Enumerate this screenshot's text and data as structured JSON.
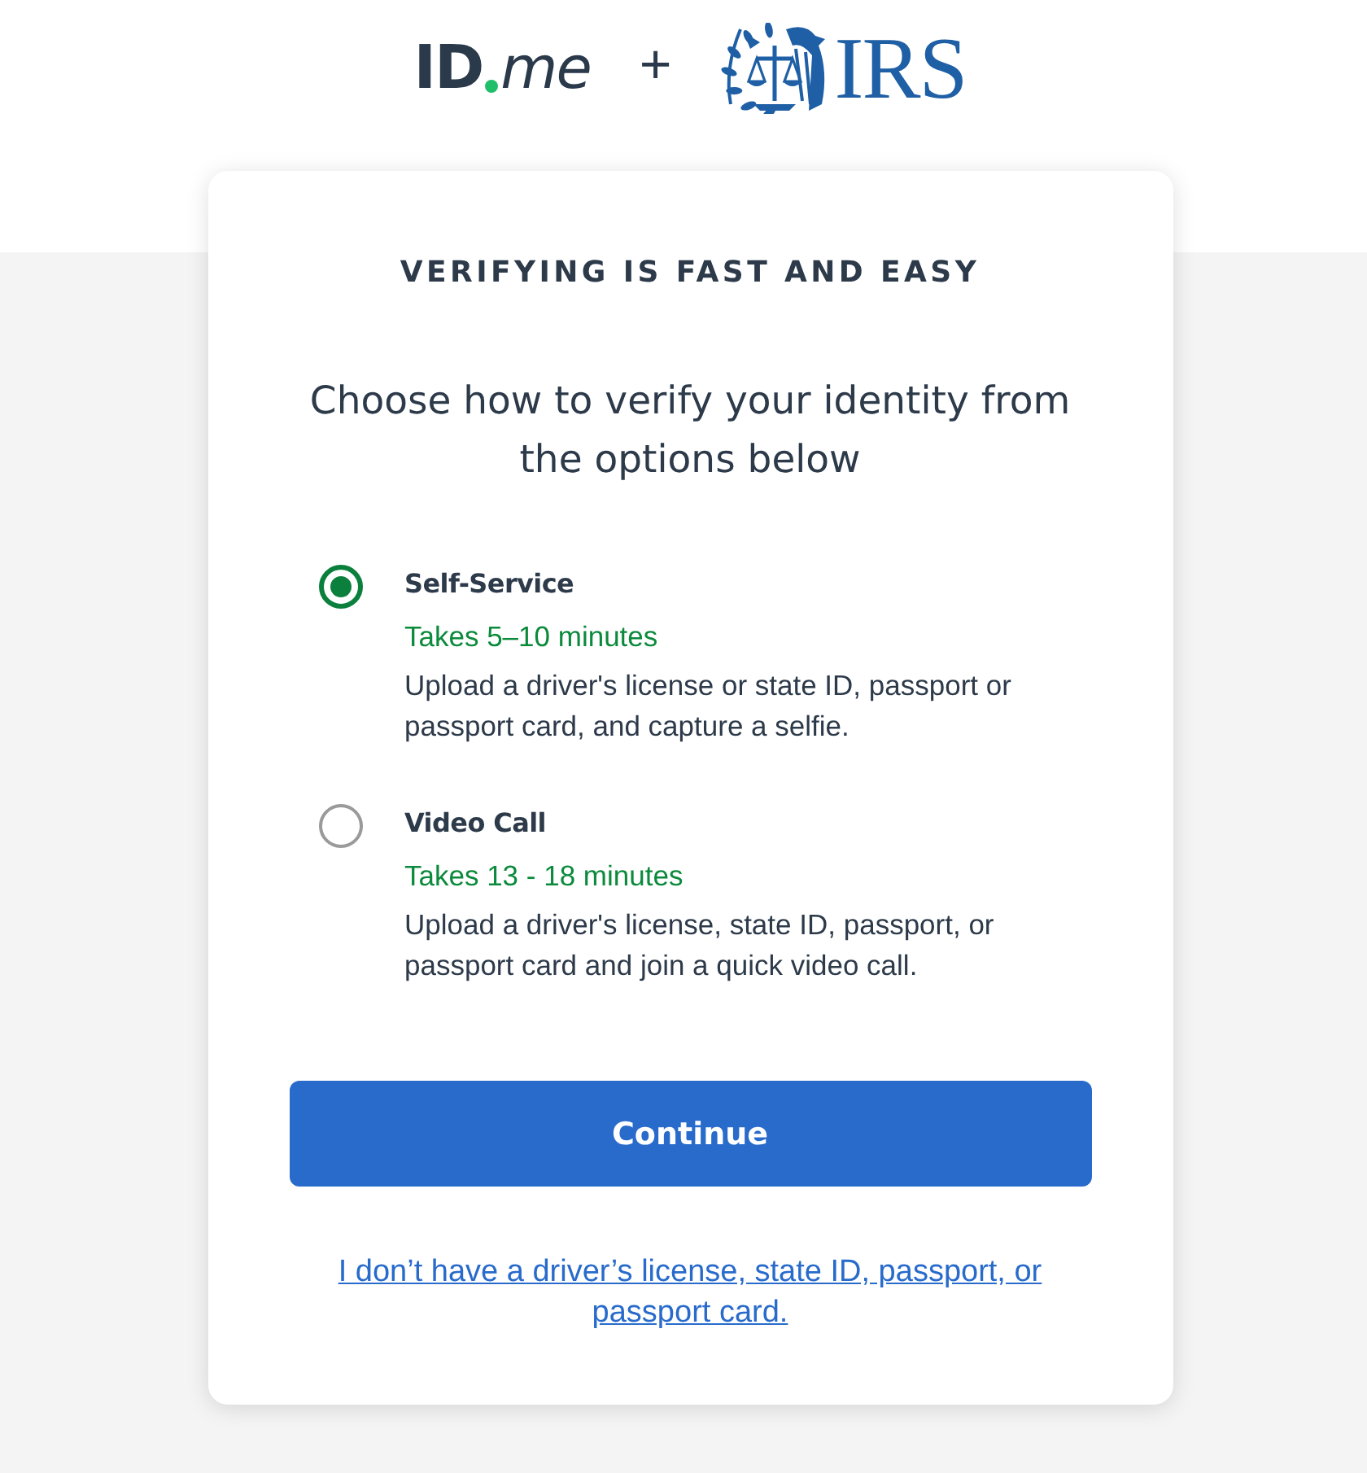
{
  "header": {
    "idme_logo": {
      "left": "ID",
      "right": "me"
    },
    "joiner": "+",
    "irs_logo": {
      "text": "IRS"
    }
  },
  "card": {
    "eyebrow": "VERIFYING IS FAST AND EASY",
    "title": "Choose how to verify your identity from the options below",
    "options": [
      {
        "title": "Self-Service",
        "duration": "Takes 5–10 minutes",
        "description": "Upload a driver's license or state ID, passport or passport card, and capture a selfie.",
        "selected": true
      },
      {
        "title": "Video Call",
        "duration": "Takes 13 - 18 minutes",
        "description": "Upload a driver's license, state ID, passport, or passport card and join a quick video call.",
        "selected": false
      }
    ],
    "continue_button": "Continue",
    "link": "I don’t have a driver’s license, state ID, passport, or passport card."
  }
}
